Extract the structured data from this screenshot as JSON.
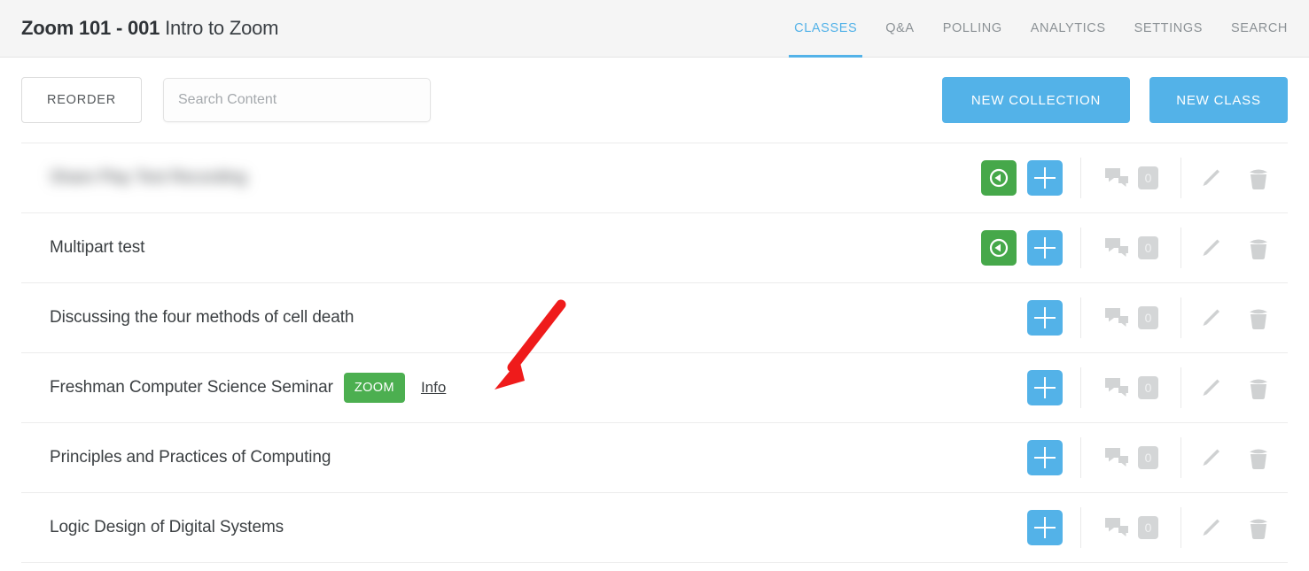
{
  "header": {
    "course_code": "Zoom 101 - 001",
    "course_name": "Intro to Zoom",
    "tabs": [
      {
        "label": "CLASSES",
        "active": true
      },
      {
        "label": "Q&A",
        "active": false
      },
      {
        "label": "POLLING",
        "active": false
      },
      {
        "label": "ANALYTICS",
        "active": false
      },
      {
        "label": "SETTINGS",
        "active": false
      },
      {
        "label": "SEARCH",
        "active": false
      }
    ],
    "accent_color": "#53b2e8",
    "background_color": "#f5f5f5"
  },
  "toolbar": {
    "reorder_label": "REORDER",
    "search_placeholder": "Search Content",
    "search_value": "",
    "new_collection_label": "NEW COLLECTION",
    "new_class_label": "NEW CLASS",
    "primary_button_color": "#53b2e8"
  },
  "list": {
    "rows": [
      {
        "title": "Share Play Test Recording",
        "blurred": true,
        "has_record_button": true,
        "badge": null,
        "info_link": null,
        "comment_count": "0"
      },
      {
        "title": "Multipart test",
        "blurred": false,
        "has_record_button": true,
        "badge": null,
        "info_link": null,
        "comment_count": "0"
      },
      {
        "title": "Discussing the four methods of cell death",
        "blurred": false,
        "has_record_button": false,
        "badge": null,
        "info_link": null,
        "comment_count": "0"
      },
      {
        "title": "Freshman Computer Science Seminar",
        "blurred": false,
        "has_record_button": false,
        "badge": "ZOOM",
        "info_link": "Info",
        "comment_count": "0"
      },
      {
        "title": "Principles and Practices of Computing",
        "blurred": false,
        "has_record_button": false,
        "badge": null,
        "info_link": null,
        "comment_count": "0"
      },
      {
        "title": "Logic Design of Digital Systems",
        "blurred": false,
        "has_record_button": false,
        "badge": null,
        "info_link": null,
        "comment_count": "0"
      }
    ],
    "icons": {
      "record": "record-play-icon",
      "add": "plus-icon",
      "comments": "chat-bubbles-icon",
      "edit": "pencil-icon",
      "delete": "trash-icon"
    },
    "colors": {
      "record_button": "#46a84a",
      "add_button": "#53b2e8",
      "zoom_badge": "#4caf50",
      "muted_icon": "#d2d4d5"
    }
  },
  "annotation": {
    "arrow_color": "#ef1b1b",
    "points_to": "Info"
  }
}
